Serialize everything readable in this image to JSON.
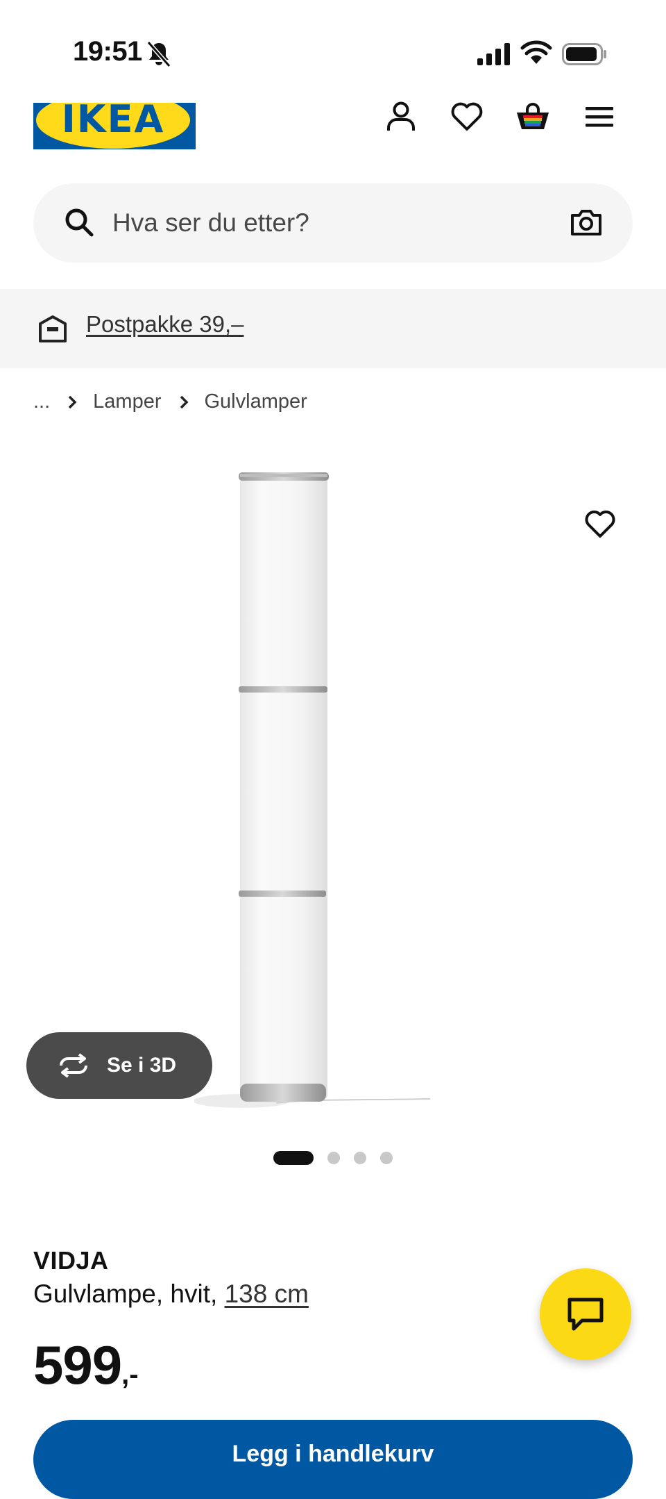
{
  "status_bar": {
    "time": "19:51",
    "icons": [
      "bell-off-icon",
      "cellular-signal-icon",
      "wifi-icon",
      "battery-icon"
    ]
  },
  "header": {
    "logo_text": "IKEA",
    "icons": [
      "profile-icon",
      "heart-icon",
      "shopping-bag-icon",
      "menu-icon"
    ]
  },
  "search": {
    "placeholder": "Hva ser du etter?",
    "icons": [
      "search-icon",
      "camera-icon"
    ]
  },
  "shipping": {
    "label": "Postpakke 39,–",
    "icon": "box-icon"
  },
  "breadcrumb": {
    "ellipsis": "...",
    "items": [
      "Lamper",
      "Gulvlamper"
    ]
  },
  "product": {
    "view_3d_label": "Se i 3D",
    "carousel": {
      "count": 4,
      "active_index": 0
    },
    "name": "VIDJA",
    "description": "Gulvlampe, hvit, ",
    "size": "138 cm",
    "price": "599",
    "price_suffix": ",-",
    "add_to_cart_label": "Legg i handlekurv"
  },
  "colors": {
    "ikea_blue": "#0058a3",
    "ikea_yellow": "#ffda1a",
    "chat_yellow": "#fbd914",
    "button_dark": "#4b4b4b"
  }
}
